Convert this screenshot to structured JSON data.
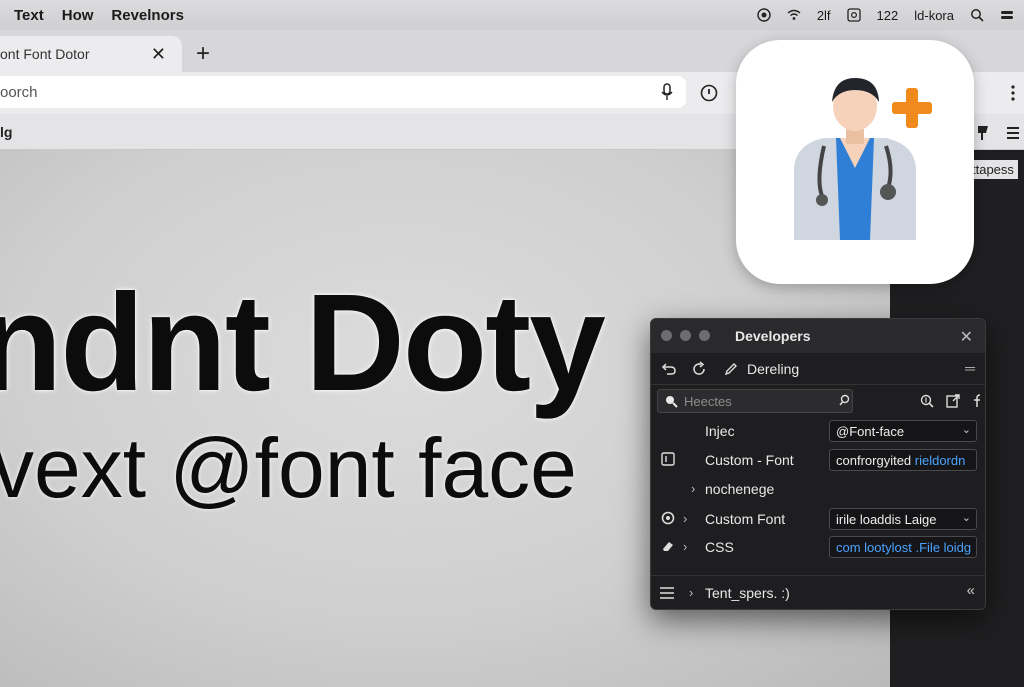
{
  "menubar": {
    "items": [
      "Text",
      "How",
      "Revelnors"
    ],
    "status": {
      "label_a": "2lf",
      "label_b": "122",
      "label_c": "ld-kora"
    }
  },
  "browser": {
    "tab_title": "ont Font Dotor",
    "tab_close": "✕",
    "new_tab": "+",
    "address_text": "oorch",
    "bookmark_label": "lg",
    "bookmark_right": "ttapess"
  },
  "page": {
    "hero_title": "ndnt Doty",
    "hero_subtitle": "vext @font face"
  },
  "devpanel": {
    "title": "Developers",
    "tool_label": "Dereling",
    "search_placeholder": "Heectes",
    "rows": [
      {
        "label": "Injec",
        "field": "@Font-face",
        "dropdown": true
      },
      {
        "label": "Custom - Font",
        "field_a": "confrorgyited ",
        "field_b": "rieldordn"
      },
      {
        "label": "nochenege"
      },
      {
        "label": "Custom Font",
        "field": "irile loaddis Laige",
        "dropdown": true
      },
      {
        "label": "CSS",
        "field_a": "com lootylost ",
        "field_b": ".File loidg"
      }
    ],
    "footer_label": "Tent_spers. :)",
    "footer_collapse": "«"
  },
  "colors": {
    "accent_blue": "#4aa3ff",
    "app_orange": "#f08a1c",
    "scrub_blue": "#2f7fd6"
  },
  "icons": {
    "app": "doctor-plus-app-icon"
  }
}
